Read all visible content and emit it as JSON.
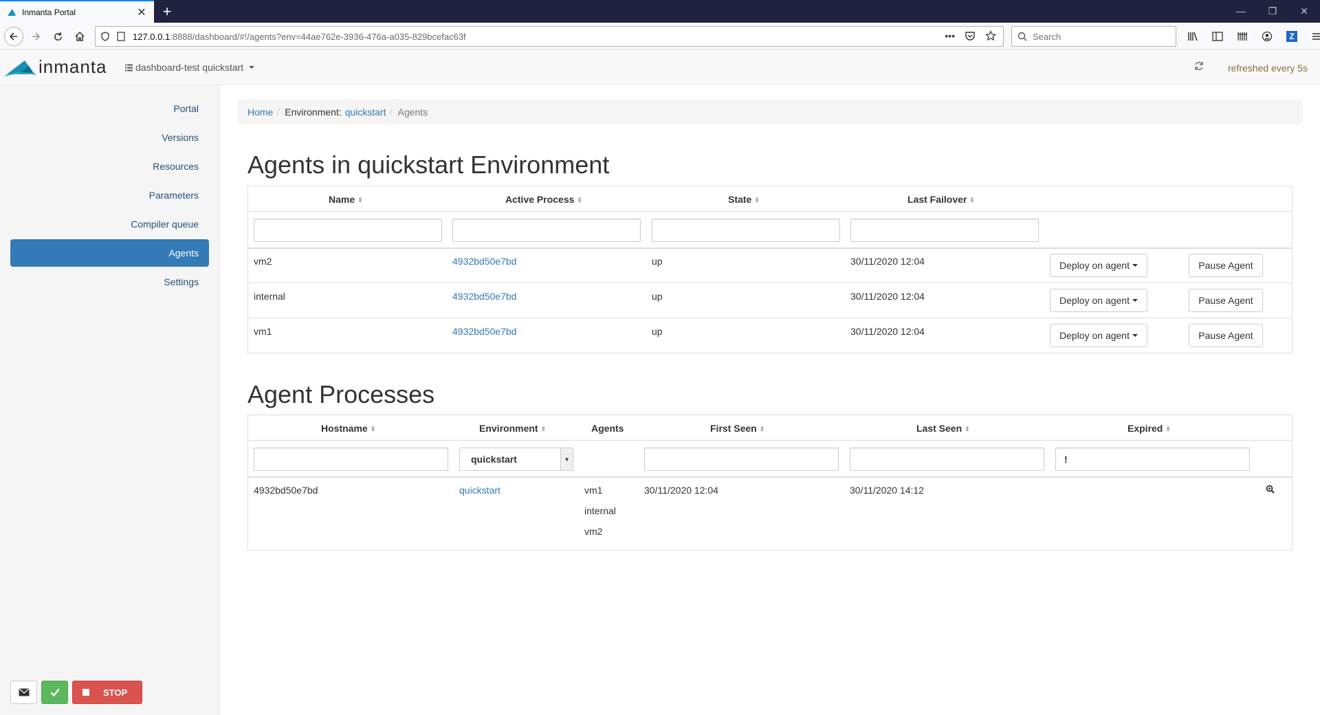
{
  "browser": {
    "tab_title": "Inmanta Portal",
    "url_host": "127.0.0.1",
    "url_rest": ":8888/dashboard/#!/agents?env=44ae762e-3936-476a-a035-829bcefac63f",
    "search_placeholder": "Search"
  },
  "header": {
    "logo_text": "inmanta",
    "env_menu": "dashboard-test quickstart",
    "refresh_text": "refreshed every 5s"
  },
  "sidebar": {
    "items": [
      {
        "label": "Portal"
      },
      {
        "label": "Versions"
      },
      {
        "label": "Resources"
      },
      {
        "label": "Parameters"
      },
      {
        "label": "Compiler queue"
      },
      {
        "label": "Agents",
        "active": true
      },
      {
        "label": "Settings"
      }
    ],
    "stop_label": "STOP"
  },
  "breadcrumb": {
    "home": "Home",
    "env_prefix": "Environment:",
    "env_name": "quickstart",
    "current": "Agents"
  },
  "agents": {
    "title": "Agents in quickstart Environment",
    "columns": [
      "Name",
      "Active Process",
      "State",
      "Last Failover"
    ],
    "deploy_label": "Deploy on agent",
    "pause_label": "Pause Agent",
    "rows": [
      {
        "name": "vm2",
        "process": "4932bd50e7bd",
        "state": "up",
        "failover": "30/11/2020 12:04"
      },
      {
        "name": "internal",
        "process": "4932bd50e7bd",
        "state": "up",
        "failover": "30/11/2020 12:04"
      },
      {
        "name": "vm1",
        "process": "4932bd50e7bd",
        "state": "up",
        "failover": "30/11/2020 12:04"
      }
    ]
  },
  "processes": {
    "title": "Agent Processes",
    "columns": [
      "Hostname",
      "Environment",
      "Agents",
      "First Seen",
      "Last Seen",
      "Expired"
    ],
    "env_filter": "quickstart",
    "expired_filter": "!",
    "rows": [
      {
        "hostname": "4932bd50e7bd",
        "environment": "quickstart",
        "agents": [
          "vm1",
          "internal",
          "vm2"
        ],
        "first_seen": "30/11/2020 12:04",
        "last_seen": "30/11/2020 14:12"
      }
    ]
  },
  "colors": {
    "link": "#337ab7",
    "active_nav": "#337ab7",
    "success": "#5cb85c",
    "danger": "#d9534f",
    "refresh_text": "#8a6d3b"
  }
}
